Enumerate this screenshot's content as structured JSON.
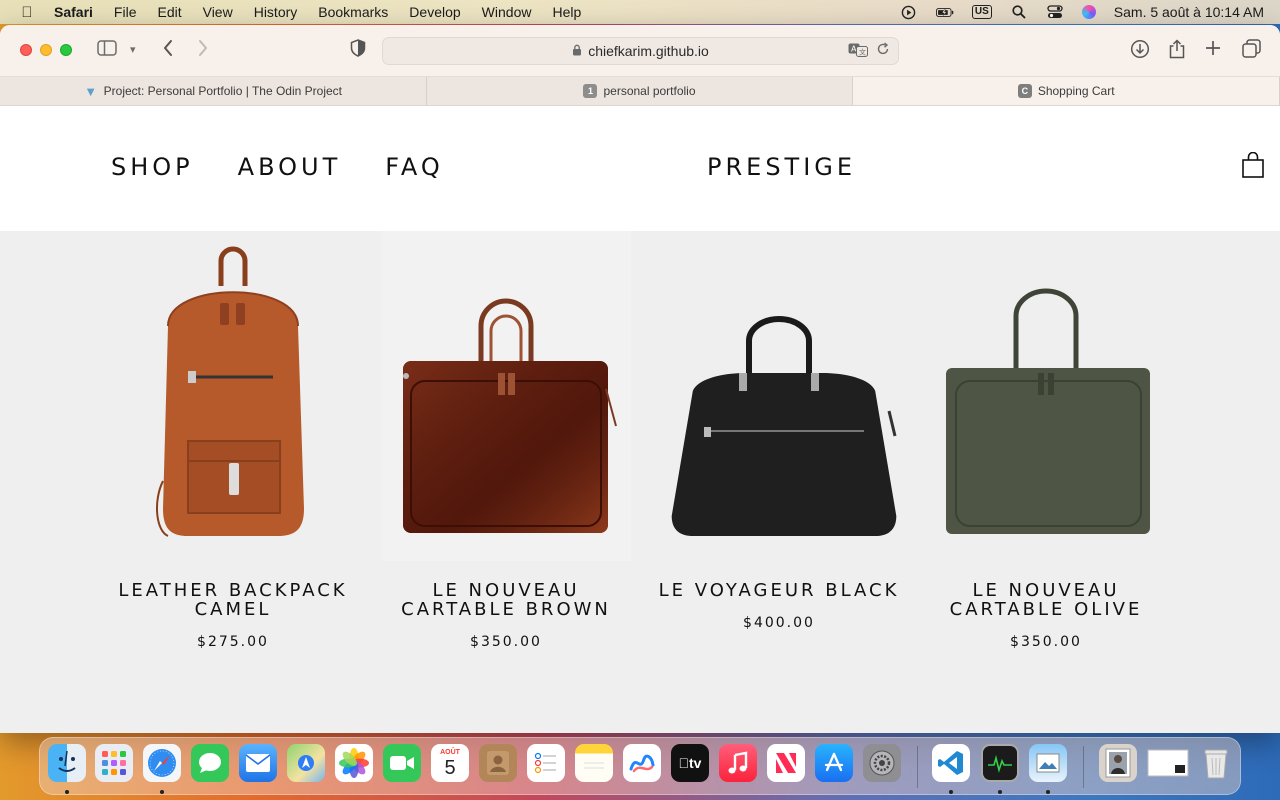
{
  "menubar": {
    "app": "Safari",
    "items": [
      "File",
      "Edit",
      "View",
      "History",
      "Bookmarks",
      "Develop",
      "Window",
      "Help"
    ],
    "input_source": "US",
    "datetime": "Sam. 5 août à 10:14 AM"
  },
  "browser": {
    "url": "chiefkarim.github.io",
    "tabs": [
      {
        "title": "Project: Personal Portfolio | The Odin Project",
        "favicon": "odin-icon"
      },
      {
        "title": "personal portfolio",
        "favicon_text": "1"
      },
      {
        "title": "Shopping Cart",
        "favicon_text": "C"
      }
    ]
  },
  "site": {
    "nav": [
      "SHOP",
      "ABOUT",
      "FAQ"
    ],
    "brand": "PRESTIGE",
    "cart_icon": "shopping-bag-icon"
  },
  "products": [
    {
      "name": "LEATHER BACKPACK CAMEL",
      "price": "$275.00",
      "color": "#b65a2c"
    },
    {
      "name": "LE NOUVEAU CARTABLE BROWN",
      "price": "$350.00",
      "color": "#5e1c10"
    },
    {
      "name": "LE VOYAGEUR BLACK",
      "price": "$400.00",
      "color": "#1f1f1f"
    },
    {
      "name": "LE NOUVEAU CARTABLE OLIVE",
      "price": "$350.00",
      "color": "#4e5545"
    }
  ],
  "dock": {
    "calendar_month": "AOÛT",
    "calendar_day": "5",
    "apps": [
      "finder-icon",
      "launchpad-icon",
      "safari-icon",
      "messages-icon",
      "mail-icon",
      "maps-icon",
      "photos-icon",
      "facetime-icon",
      "calendar-icon",
      "contacts-icon",
      "reminders-icon",
      "notes-icon",
      "freeform-icon",
      "tv-icon",
      "music-icon",
      "news-icon",
      "app-store-icon",
      "system-settings-icon",
      "vscode-icon",
      "activity-monitor-icon",
      "preview-icon",
      "downloads-stack-icon",
      "screenshot-icon",
      "trash-icon"
    ]
  }
}
